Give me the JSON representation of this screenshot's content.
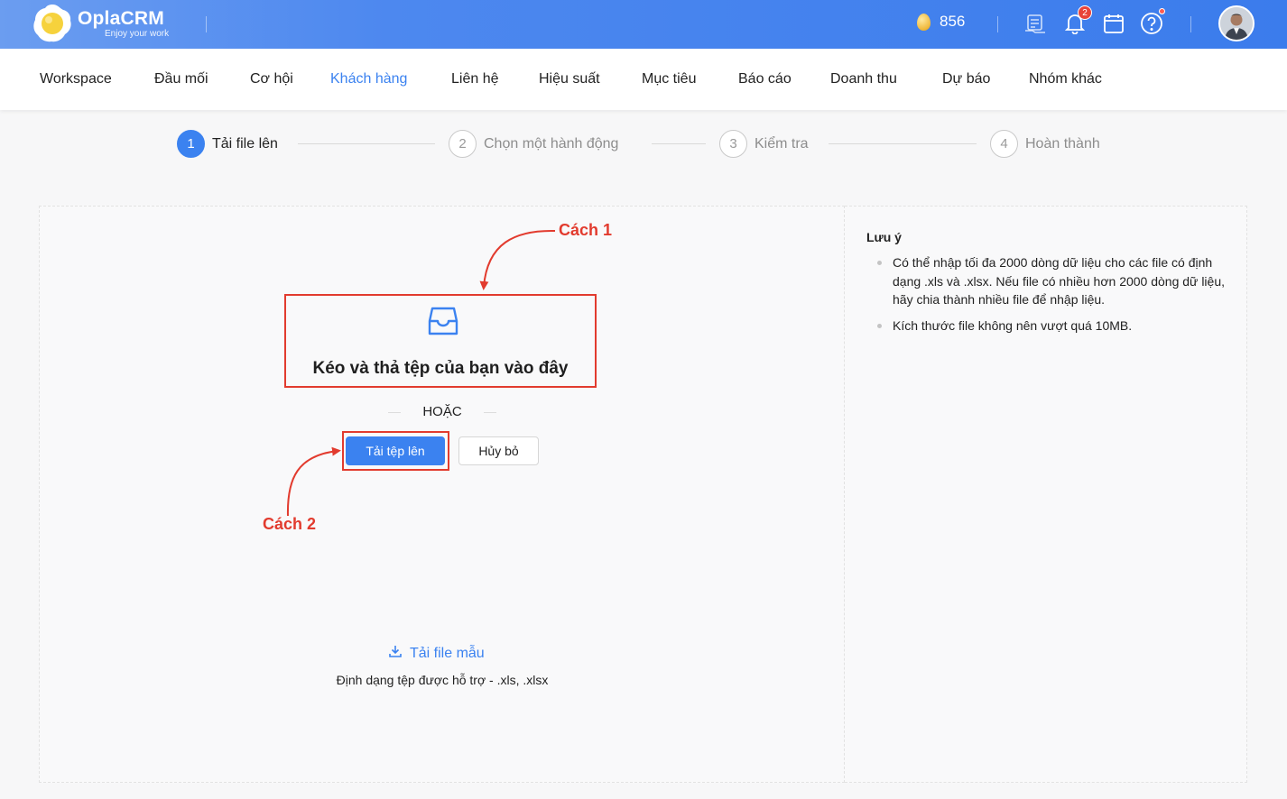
{
  "header": {
    "brand_name": "OplaCRM",
    "brand_tagline": "Enjoy your work",
    "coin_count": "856",
    "notification_count": "2",
    "icons": [
      "egg-coin-icon",
      "checklist-icon",
      "bell-icon",
      "calendar-icon",
      "help-icon"
    ]
  },
  "nav": {
    "items": [
      {
        "label": "Workspace"
      },
      {
        "label": "Đầu mối"
      },
      {
        "label": "Cơ hội"
      },
      {
        "label": "Khách hàng"
      },
      {
        "label": "Liên hệ"
      },
      {
        "label": "Hiệu suất"
      },
      {
        "label": "Mục tiêu"
      },
      {
        "label": "Báo cáo"
      },
      {
        "label": "Doanh thu"
      },
      {
        "label": "Dự báo"
      },
      {
        "label": "Nhóm khác"
      }
    ],
    "active": "Khách hàng"
  },
  "steps": [
    {
      "number": "1",
      "label": "Tải file lên",
      "active": true
    },
    {
      "number": "2",
      "label": "Chọn một hành động",
      "active": false
    },
    {
      "number": "3",
      "label": "Kiểm tra",
      "active": false
    },
    {
      "number": "4",
      "label": "Hoàn thành",
      "active": false
    }
  ],
  "upload": {
    "drop_text": "Kéo và thả tệp của bạn vào đây",
    "or_text": "HOẶC",
    "upload_button": "Tải tệp lên",
    "cancel_button": "Hủy bỏ",
    "template_link": "Tải file mẫu",
    "supported_formats": "Định dạng tệp được hỗ trợ - .xls, .xlsx"
  },
  "annotations": {
    "way1": "Cách 1",
    "way2": "Cách 2",
    "color": "#e23b2e"
  },
  "notes": {
    "title": "Lưu ý",
    "items": [
      "Có thể nhập tối đa 2000 dòng dữ liệu cho các file có định dạng .xls và .xlsx. Nếu file có nhiều hơn 2000 dòng dữ liệu, hãy chia thành nhiều file để nhập liệu.",
      "Kích thước file không nên vượt quá 10MB."
    ]
  },
  "colors": {
    "primary": "#3b82f0",
    "header_gradient_start": "#6b9df0",
    "header_gradient_end": "#3b7cec",
    "annotation_red": "#e23b2e"
  }
}
